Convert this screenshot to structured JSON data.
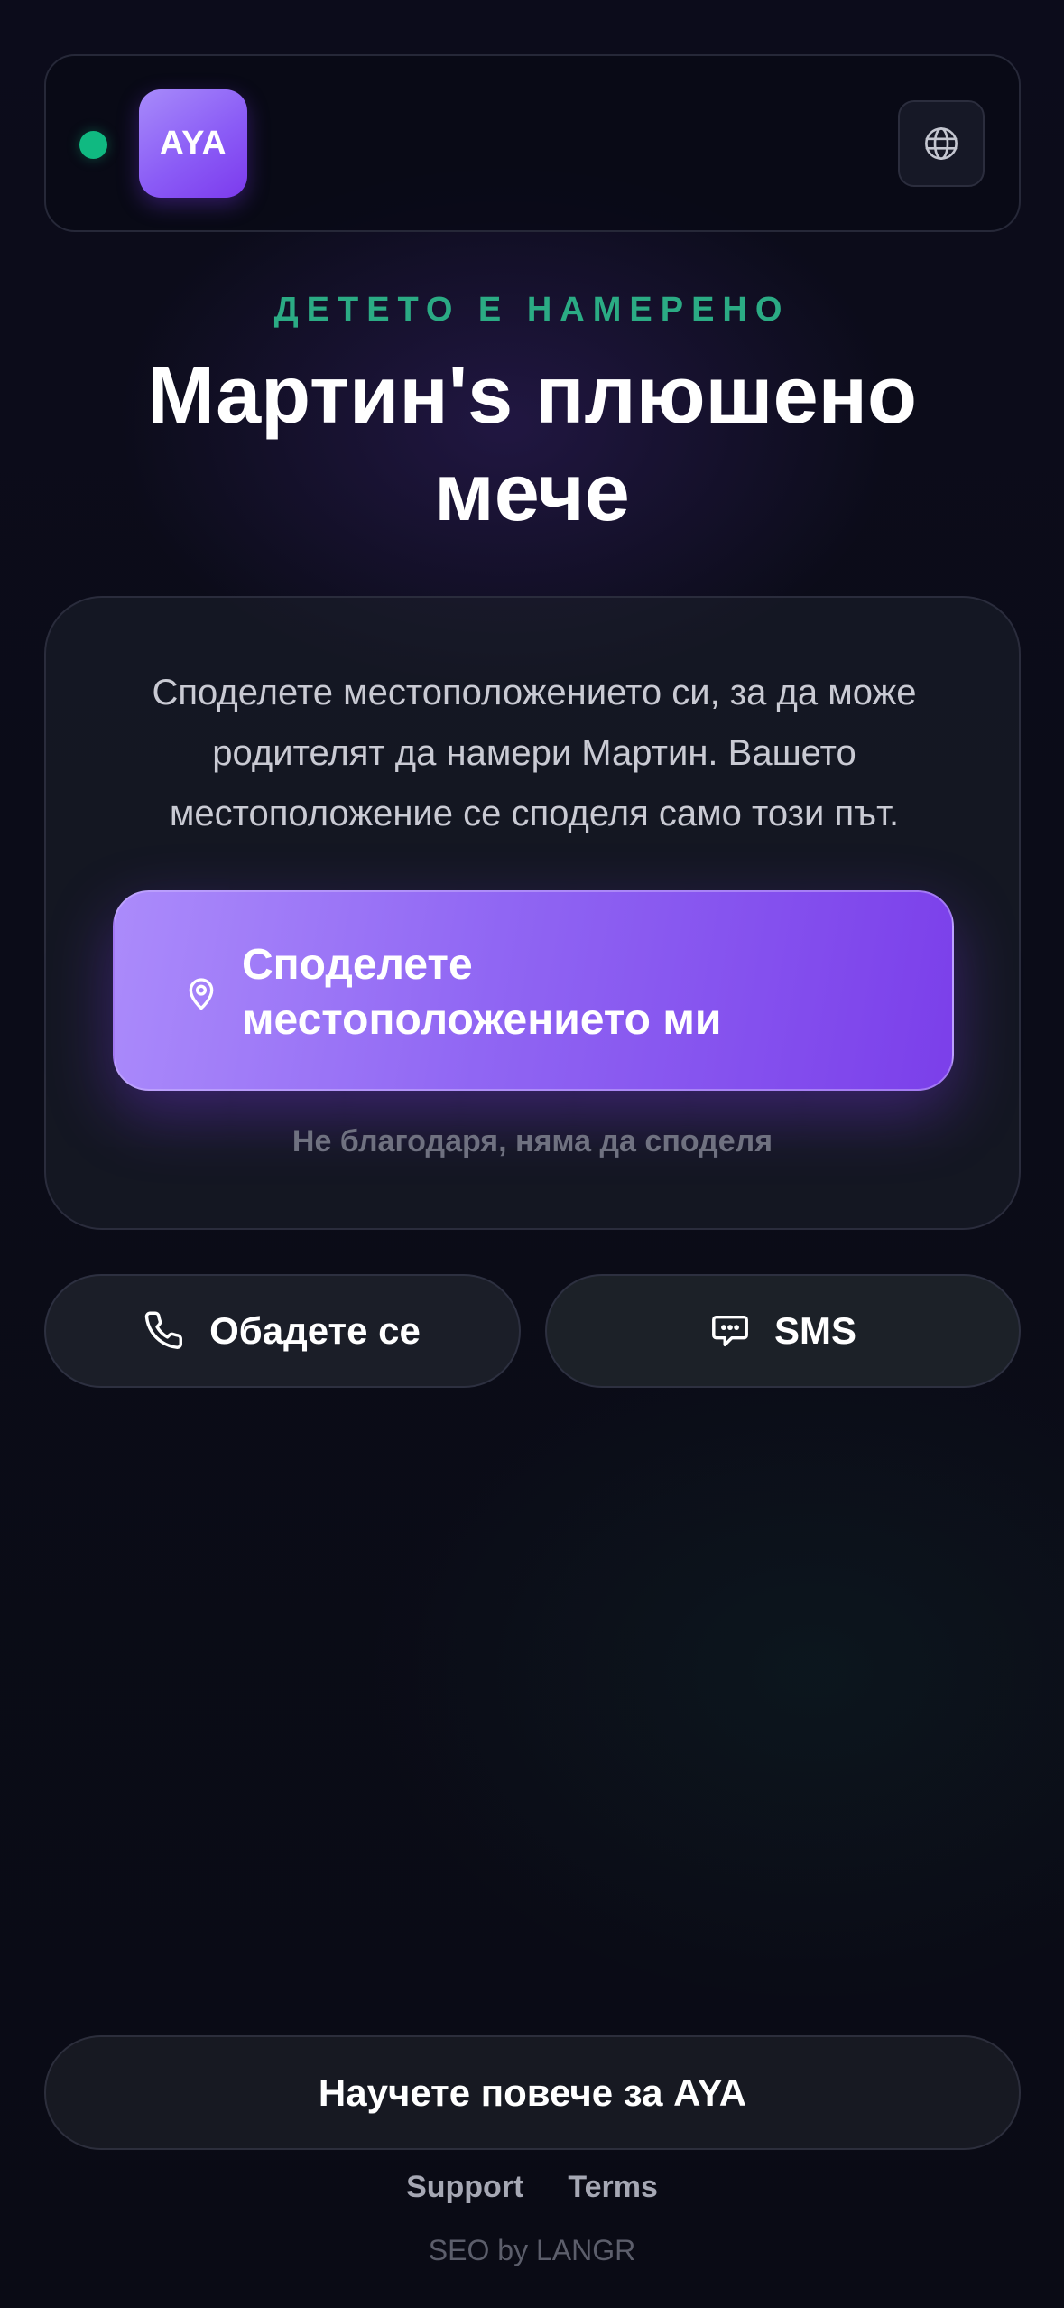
{
  "header": {
    "logo_text": "AYA",
    "status_color": "#10b981",
    "language_icon": "globe-icon"
  },
  "hero": {
    "kicker": "ДЕТЕТО Е НАМЕРЕНО",
    "title": "Мартин's плюшено мече"
  },
  "card": {
    "description": "Споделете местоположението си, за да може родителят да намери Мартин. Вашето местоположение се споделя само този път.",
    "share_button_label": "Споделете местоположението ми",
    "share_icon": "location-pin-icon",
    "decline_label": "Не благодаря, няма да споделя"
  },
  "contact": {
    "call_label": "Обадете се",
    "call_icon": "phone-icon",
    "sms_label": "SMS",
    "sms_icon": "chat-bubble-icon"
  },
  "footer": {
    "learn_more_label": "Научете повече за AYA",
    "links": [
      "Support",
      "Terms"
    ],
    "credit": "SEO by LANGR"
  },
  "colors": {
    "accent_purple": "#8b5cf6",
    "kicker_green": "#2bab84",
    "background": "#0c0c1b"
  }
}
